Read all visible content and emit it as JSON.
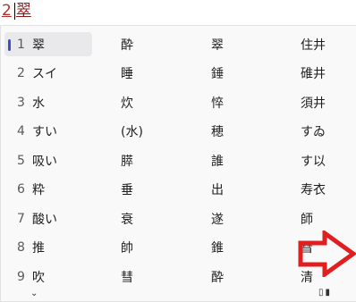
{
  "composition": {
    "number": "2",
    "text": "翠"
  },
  "candidates": [
    {
      "index": "1",
      "cols": [
        "翠",
        "酔",
        "翠",
        "住井"
      ]
    },
    {
      "index": "2",
      "cols": [
        "スイ",
        "睡",
        "錘",
        "碓井"
      ]
    },
    {
      "index": "3",
      "cols": [
        "水",
        "炊",
        "悴",
        "須井"
      ]
    },
    {
      "index": "4",
      "cols": [
        "すい",
        "(水)",
        "穂",
        "すゐ"
      ]
    },
    {
      "index": "5",
      "cols": [
        "吸い",
        "膵",
        "誰",
        "す以"
      ]
    },
    {
      "index": "6",
      "cols": [
        "粋",
        "垂",
        "出",
        "寿衣"
      ]
    },
    {
      "index": "7",
      "cols": [
        "酸い",
        "衰",
        "遂",
        "師"
      ]
    },
    {
      "index": "8",
      "cols": [
        "推",
        "帥",
        "錐",
        "彗"
      ]
    },
    {
      "index": "9",
      "cols": [
        "吹",
        "彗",
        "酔",
        "清"
      ]
    }
  ],
  "selected_index": "1",
  "colors": {
    "accent": "#3a4fd0",
    "composition_text": "#8a1a1a",
    "arrow": "#e02020"
  },
  "icons": {
    "footer_left": "options-chevron-icon",
    "footer_right": "expand-window-icon",
    "overlay": "right-arrow-icon"
  }
}
